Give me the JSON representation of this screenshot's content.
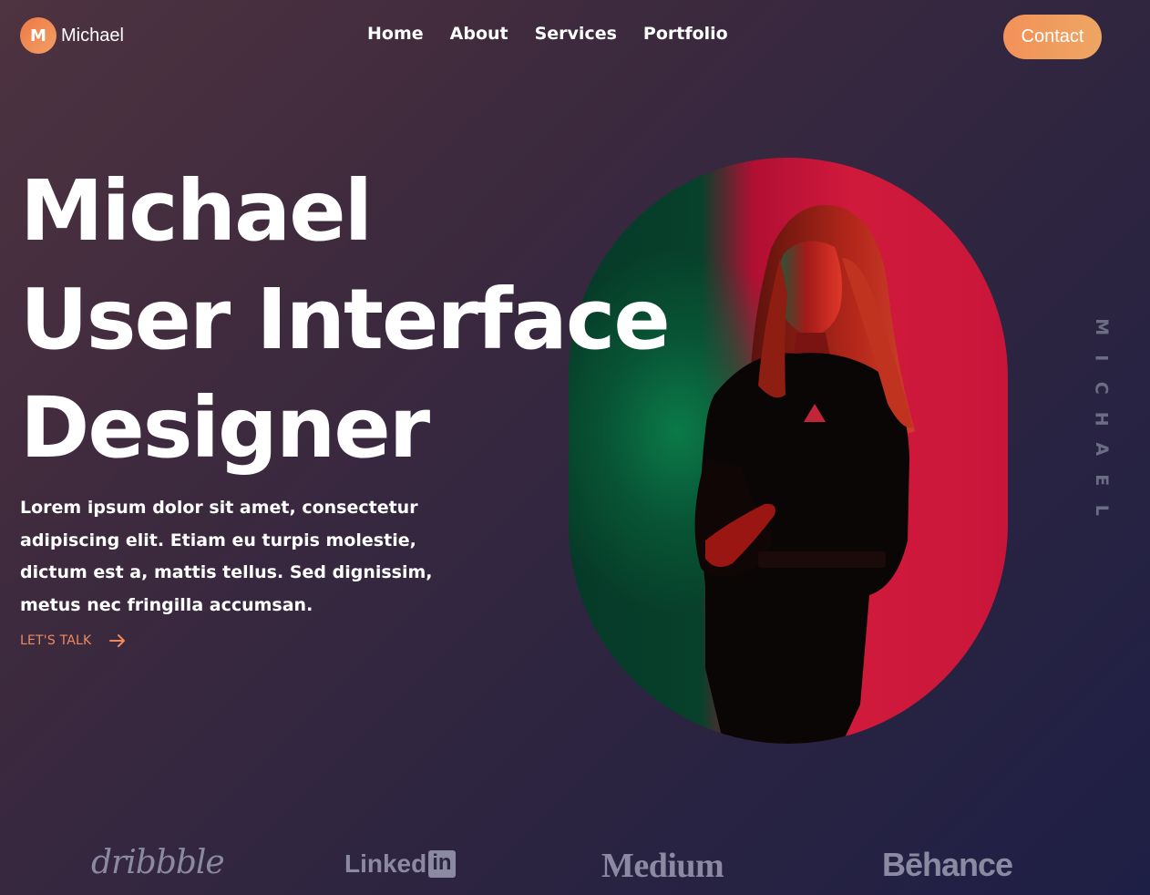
{
  "header": {
    "logo_initial": "M",
    "logo_name": "Michael",
    "nav": [
      {
        "label": "Home"
      },
      {
        "label": "About"
      },
      {
        "label": "Services"
      },
      {
        "label": "Portfolio"
      }
    ],
    "contact_label": "Contact"
  },
  "hero": {
    "title_lines": [
      "Michael",
      "User Interface",
      "Designer"
    ],
    "description": "Lorem ipsum dolor sit amet, consectetur adipiscing elit. Etiam eu turpis molestie, dictum est a, mattis tellus. Sed dignissim, metus nec fringilla accumsan.",
    "cta_label": "LET'S TALK",
    "cta_icon": "arrow-right-icon",
    "vertical_name_letters": [
      "M",
      "I",
      "C",
      "H",
      "A",
      "E",
      "L"
    ]
  },
  "brands": [
    "dribbble",
    "Linked",
    "in",
    "Medium",
    "Bēhance"
  ],
  "colors": {
    "accent": "#f0925c",
    "background_start": "#4e3340",
    "background_end": "#1e1f45",
    "muted_text": "#8c8aa2"
  }
}
